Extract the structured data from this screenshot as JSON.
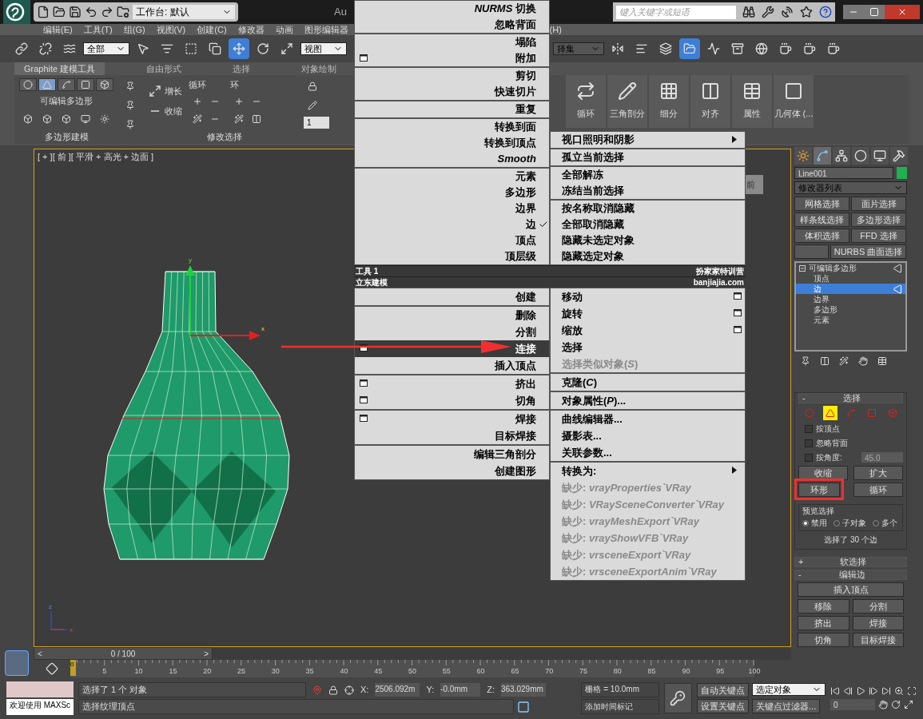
{
  "title_bar": {
    "workspace": "工作台: 默认",
    "title": "Au",
    "search_placeholder": "键入关键字或短语"
  },
  "menu_bar": [
    "编辑(E)",
    "工具(T)",
    "组(G)",
    "视图(V)",
    "创建(C)",
    "修改器",
    "动画",
    "图形编辑器",
    "(H)"
  ],
  "main_toolbar": {
    "selection_filter": "全部",
    "reference_coord": "视图",
    "named_selection": "择集"
  },
  "ribbon": {
    "tabs": [
      {
        "label": "Graphite 建模工具",
        "selected": true
      },
      {
        "label": "自由形式",
        "selected": false
      },
      {
        "label": "选择",
        "selected": false
      },
      {
        "label": "对象绘制",
        "selected": false
      }
    ],
    "subobject_levels": [
      {
        "selected": false
      },
      {
        "selected": true
      },
      {
        "selected": false
      },
      {
        "selected": false
      },
      {
        "selected": false
      }
    ],
    "object_type": "可编辑多边形",
    "polygon_panel": "多边形建模",
    "grow": "增长",
    "shrink": "收缩",
    "loop": "循环",
    "ring": "环",
    "modify_panel": "修改选择",
    "spinner": "1",
    "tools": [
      "循环",
      "三角剖分",
      "细分",
      "对齐",
      "属性",
      "几何体 (..."
    ]
  },
  "viewport": {
    "label": "[ + ][ 前 ][ 平滑 + 高光 + 边面 ]",
    "viewcube": "前",
    "gizmo_x": "x",
    "gizmo_y": "y",
    "axis_z": "z",
    "axis_x": "x"
  },
  "quad_menu": {
    "top_left": [
      [
        {
          "label": "*NURMS* 切换",
          "kind": "plain",
          "selected": false,
          "checked": false
        },
        {
          "label": "忽略背面",
          "kind": "plain",
          "selected": false,
          "checked": false
        }
      ],
      [
        {
          "label": "塌陷",
          "kind": "plain",
          "selected": false,
          "checked": false
        },
        {
          "label": "附加",
          "kind": "settings",
          "selected": false,
          "checked": false
        }
      ],
      [
        {
          "label": "剪切",
          "kind": "plain",
          "selected": false,
          "checked": false
        },
        {
          "label": "快速切片",
          "kind": "plain",
          "selected": false,
          "checked": false
        }
      ],
      [
        {
          "label": "重复",
          "kind": "plain",
          "selected": false,
          "checked": false
        }
      ],
      [
        {
          "label": "转换到面",
          "kind": "plain",
          "selected": false,
          "checked": false
        },
        {
          "label": "转换到顶点",
          "kind": "plain",
          "selected": false,
          "checked": false
        },
        {
          "label": "*Smooth*",
          "kind": "plain",
          "selected": false,
          "checked": false
        }
      ],
      [
        {
          "label": "元素",
          "kind": "plain",
          "selected": false,
          "checked": false
        },
        {
          "label": "多边形",
          "kind": "plain",
          "selected": false,
          "checked": false
        },
        {
          "label": "边界",
          "kind": "plain",
          "selected": false,
          "checked": false
        },
        {
          "label": "边",
          "kind": "plain",
          "selected": false,
          "checked": true
        },
        {
          "label": "顶点",
          "kind": "plain",
          "selected": false,
          "checked": false
        },
        {
          "label": "顶层级",
          "kind": "plain",
          "selected": false,
          "checked": false
        }
      ]
    ],
    "top_right": [
      [
        {
          "label": "视口照明和阴影",
          "kind": "submenu",
          "selected": false,
          "checked": false
        }
      ],
      [
        {
          "label": "孤立当前选择",
          "kind": "plain",
          "selected": false,
          "checked": false
        }
      ],
      [
        {
          "label": "全部解冻",
          "kind": "plain",
          "selected": false,
          "checked": false
        },
        {
          "label": "冻结当前选择",
          "kind": "plain",
          "selected": false,
          "checked": false
        }
      ],
      [
        {
          "label": "按名称取消隐藏",
          "kind": "plain",
          "selected": false,
          "checked": false
        },
        {
          "label": "全部取消隐藏",
          "kind": "plain",
          "selected": false,
          "checked": false
        },
        {
          "label": "隐藏未选定对象",
          "kind": "plain",
          "selected": false,
          "checked": false
        },
        {
          "label": "隐藏选定对象",
          "kind": "plain",
          "selected": false,
          "checked": false
        }
      ]
    ],
    "titles": [
      {
        "left": "工具 1",
        "right": "扮家家特训营"
      },
      {
        "left": "立东建模",
        "right": "banjiajia.com"
      }
    ],
    "bottom_left": [
      [
        {
          "label": "创建",
          "kind": "plain",
          "selected": false,
          "checked": false
        }
      ],
      [
        {
          "label": "删除",
          "kind": "plain",
          "selected": false,
          "checked": false
        },
        {
          "label": "分割",
          "kind": "plain",
          "selected": false,
          "checked": false
        },
        {
          "label": "连接",
          "kind": "settings",
          "selected": true,
          "checked": false
        },
        {
          "label": "插入顶点",
          "kind": "plain",
          "selected": false,
          "checked": false
        }
      ],
      [
        {
          "label": "挤出",
          "kind": "settings",
          "selected": false,
          "checked": false
        },
        {
          "label": "切角",
          "kind": "settings",
          "selected": false,
          "checked": false
        }
      ],
      [
        {
          "label": "焊接",
          "kind": "settings",
          "selected": false,
          "checked": false
        },
        {
          "label": "目标焊接",
          "kind": "plain",
          "selected": false,
          "checked": false
        }
      ],
      [
        {
          "label": "编辑三角剖分",
          "kind": "plain",
          "selected": false,
          "checked": false
        },
        {
          "label": "创建图形",
          "kind": "plain",
          "selected": false,
          "checked": false
        }
      ]
    ],
    "bottom_right": [
      [
        {
          "label": "移动",
          "kind": "settings",
          "selected": false,
          "checked": false
        },
        {
          "label": "旋转",
          "kind": "settings",
          "selected": false,
          "checked": false
        },
        {
          "label": "缩放",
          "kind": "settings",
          "selected": false,
          "checked": false
        },
        {
          "label": "选择",
          "kind": "plain",
          "selected": false,
          "checked": false
        },
        {
          "label": "选择类似对象(*S*)",
          "kind": "disabled",
          "selected": false,
          "checked": false
        }
      ],
      [
        {
          "label": "克隆(*C*)",
          "kind": "plain",
          "selected": false,
          "checked": false
        }
      ],
      [
        {
          "label": "对象属性(*P*)...",
          "kind": "plain",
          "selected": false,
          "checked": false
        }
      ],
      [
        {
          "label": "曲线编辑器...",
          "kind": "plain",
          "selected": false,
          "checked": false
        },
        {
          "label": "摄影表...",
          "kind": "plain",
          "selected": false,
          "checked": false
        },
        {
          "label": "关联参数...",
          "kind": "plain",
          "selected": false,
          "checked": false
        }
      ],
      [
        {
          "label": "转换为:",
          "kind": "submenu",
          "selected": false,
          "checked": false
        },
        {
          "label": "缺少: *vrayProperties`VRay*",
          "kind": "disabled",
          "selected": false,
          "checked": false
        },
        {
          "label": "缺少: *VRaySceneConverter`VRay*",
          "kind": "disabled",
          "selected": false,
          "checked": false
        },
        {
          "label": "缺少: *vrayMeshExport`VRay*",
          "kind": "disabled",
          "selected": false,
          "checked": false
        },
        {
          "label": "缺少: *vrayShowVFB`VRay*",
          "kind": "disabled",
          "selected": false,
          "checked": false
        },
        {
          "label": "缺少: *vrsceneExport`VRay*",
          "kind": "disabled",
          "selected": false,
          "checked": false
        },
        {
          "label": "缺少: *vrsceneExportAnim`VRay*",
          "kind": "disabled",
          "selected": false,
          "checked": false
        }
      ]
    ]
  },
  "command_panel": {
    "tabs": [
      {
        "selected": false
      },
      {
        "selected": true
      },
      {
        "selected": false
      },
      {
        "selected": false
      },
      {
        "selected": false
      },
      {
        "selected": false
      }
    ],
    "object_name": "Line001",
    "modifier_list": "修改器列表",
    "modifier_buttons": [
      {
        "kind": "label",
        "label": "网格选择"
      },
      {
        "kind": "label",
        "label": "面片选择"
      },
      {
        "kind": "label",
        "label": "样条线选择"
      },
      {
        "kind": "label",
        "label": "多边形选择"
      },
      {
        "kind": "label",
        "label": "体积选择"
      },
      {
        "kind": "label",
        "label": "FFD 选择"
      },
      {
        "kind": "blank"
      },
      {
        "kind": "label",
        "label": "NURBS 曲面选择"
      }
    ],
    "stack": [
      {
        "label": "可编辑多边形",
        "selected": false,
        "expanded": true,
        "children": [
          {
            "label": "顶点",
            "selected": false
          },
          {
            "label": "边",
            "selected": true
          },
          {
            "label": "边界",
            "selected": false
          },
          {
            "label": "多边形",
            "selected": false
          },
          {
            "label": "元素",
            "selected": false
          }
        ]
      }
    ],
    "selection": {
      "toggle": "-",
      "title": "选择",
      "levels": [
        {
          "selected": false
        },
        {
          "selected": true
        },
        {
          "selected": false
        },
        {
          "selected": false
        },
        {
          "selected": false
        }
      ],
      "checkboxes": [
        {
          "label": "按顶点",
          "checked": false
        },
        {
          "label": "忽略背面",
          "checked": false
        },
        {
          "label": "按角度:",
          "checked": false
        }
      ],
      "angle": "45.0",
      "shrink": "收缩",
      "grow": "扩大",
      "ring": "环形",
      "loop": "循环",
      "preview_title": "预览选择",
      "preview": [
        {
          "label": "禁用",
          "selected": true
        },
        {
          "label": "子对象",
          "selected": false
        },
        {
          "label": "多个",
          "selected": false
        }
      ],
      "summary": "选择了 30 个边"
    },
    "soft_selection": {
      "toggle": "+",
      "title": "软选择"
    },
    "edit_edges": {
      "toggle": "-",
      "title": "编辑边",
      "buttons": [
        [
          "插入顶点"
        ],
        [
          "移除",
          "分割"
        ],
        [
          "挤出",
          "焊接"
        ],
        [
          "切角",
          "目标焊接"
        ]
      ]
    }
  },
  "timeline": {
    "prev": "<",
    "position": "0 / 100",
    "next": ">",
    "ticks": [
      "5",
      "10",
      "15",
      "20",
      "25",
      "30",
      "35",
      "40",
      "45",
      "50",
      "55",
      "60",
      "65",
      "70",
      "75",
      "80",
      "85",
      "90",
      "95",
      "100"
    ],
    "thumb": "0"
  },
  "status_bar": {
    "listener": "欢迎使用 MAXSc",
    "selection": "选择了 1 个 对象",
    "prompt": "选择纹理顶点",
    "x_label": "X:",
    "x": "2506.092m",
    "y_label": "Y:",
    "y": "-0.0mm",
    "z_label": "Z:",
    "z": "363.029mm",
    "grid": "栅格 = 10.0mm",
    "add_time_tag": "添加时间标记",
    "auto_key": "自动关键点",
    "key_mode": "选定对象",
    "set_key": "设置关键点",
    "key_filters": "关键点过滤器...",
    "frame": "0"
  }
}
